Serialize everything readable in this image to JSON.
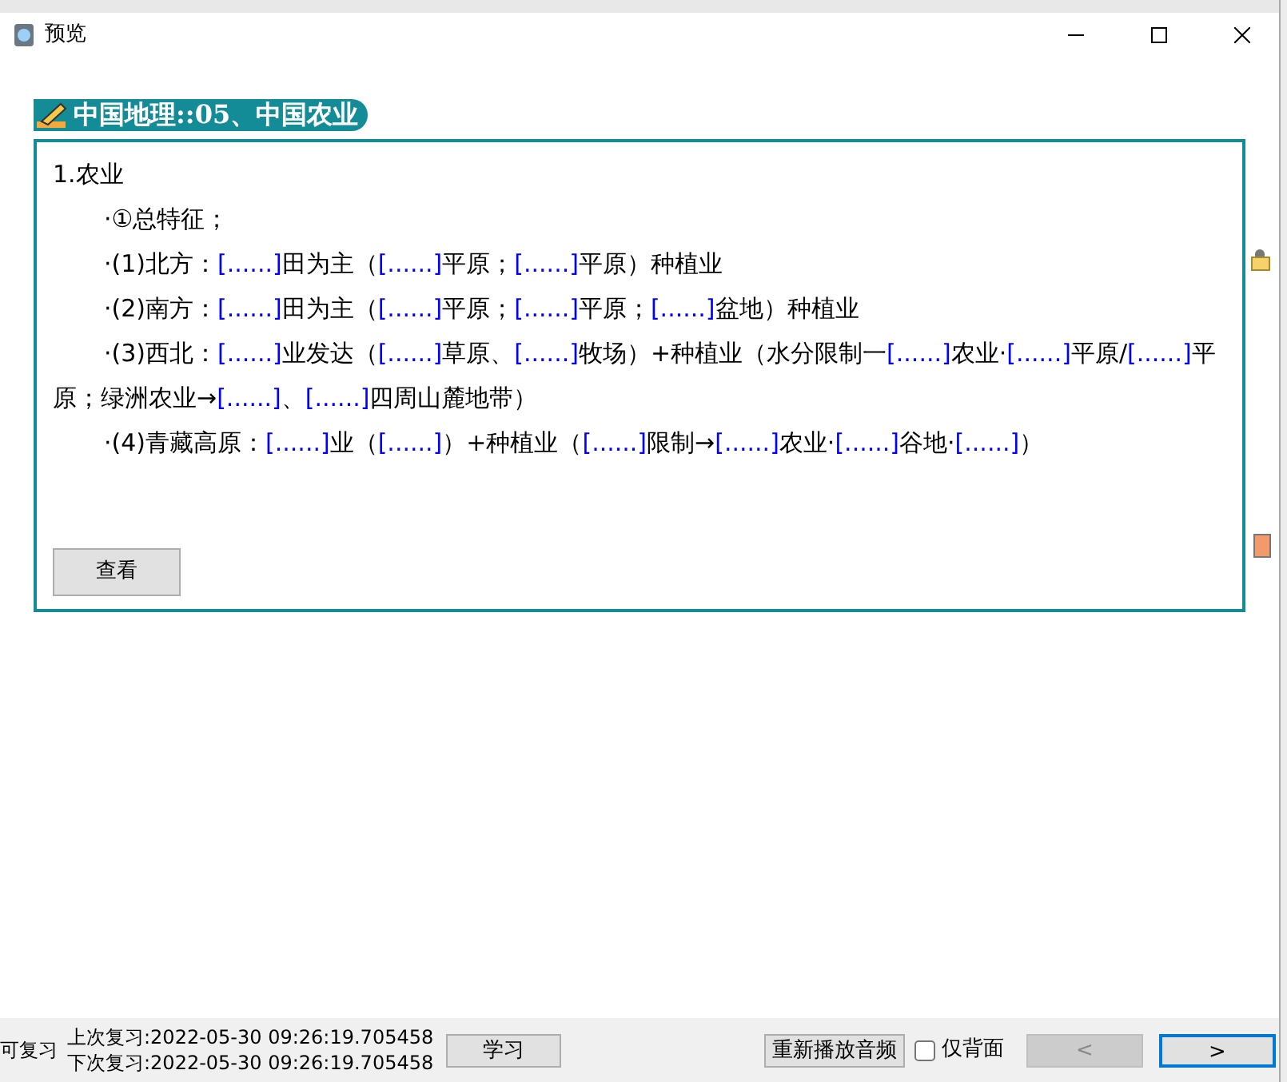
{
  "window": {
    "title": "预览"
  },
  "card": {
    "title": "中国地理::05、中国农业",
    "lines": [
      {
        "indent": false,
        "segments": [
          {
            "kind": "text",
            "text": "1.农业"
          }
        ]
      },
      {
        "indent": true,
        "segments": [
          {
            "kind": "text",
            "text": "·①总特征；"
          }
        ]
      },
      {
        "indent": true,
        "segments": [
          {
            "kind": "text",
            "text": "·(1)北方："
          },
          {
            "kind": "blank",
            "text": "[......]"
          },
          {
            "kind": "text",
            "text": "田为主（"
          },
          {
            "kind": "blank",
            "text": "[......]"
          },
          {
            "kind": "text",
            "text": "平原；"
          },
          {
            "kind": "blank",
            "text": "[......]"
          },
          {
            "kind": "text",
            "text": "平原）种植业"
          }
        ]
      },
      {
        "indent": true,
        "segments": [
          {
            "kind": "text",
            "text": "·(2)南方："
          },
          {
            "kind": "blank",
            "text": "[......]"
          },
          {
            "kind": "text",
            "text": "田为主（"
          },
          {
            "kind": "blank",
            "text": "[......]"
          },
          {
            "kind": "text",
            "text": "平原；"
          },
          {
            "kind": "blank",
            "text": "[......]"
          },
          {
            "kind": "text",
            "text": "平原；"
          },
          {
            "kind": "blank",
            "text": "[......]"
          },
          {
            "kind": "text",
            "text": "盆地）种植业"
          }
        ]
      },
      {
        "indent": true,
        "segments": [
          {
            "kind": "text",
            "text": "·(3)西北："
          },
          {
            "kind": "blank",
            "text": "[......]"
          },
          {
            "kind": "text",
            "text": "业发达（"
          },
          {
            "kind": "blank",
            "text": "[......]"
          },
          {
            "kind": "text",
            "text": "草原、"
          },
          {
            "kind": "blank",
            "text": "[......]"
          },
          {
            "kind": "text",
            "text": "牧场）+种植业（水分限制一"
          },
          {
            "kind": "blank",
            "text": "[......]"
          },
          {
            "kind": "text",
            "text": "农业·"
          },
          {
            "kind": "blank",
            "text": "[......]"
          },
          {
            "kind": "text",
            "text": "平原/"
          },
          {
            "kind": "blank",
            "text": "[......]"
          },
          {
            "kind": "text",
            "text": "平原；绿洲农业→"
          },
          {
            "kind": "blank",
            "text": "[......]"
          },
          {
            "kind": "text",
            "text": "、"
          },
          {
            "kind": "blank",
            "text": "[......]"
          },
          {
            "kind": "text",
            "text": "四周山麓地带）"
          }
        ]
      },
      {
        "indent": true,
        "segments": [
          {
            "kind": "text",
            "text": "·(4)青藏高原："
          },
          {
            "kind": "blank",
            "text": "[......]"
          },
          {
            "kind": "text",
            "text": "业（"
          },
          {
            "kind": "blank",
            "text": "[......]"
          },
          {
            "kind": "text",
            "text": "）+种植业（"
          },
          {
            "kind": "blank",
            "text": "[......]"
          },
          {
            "kind": "text",
            "text": "限制→"
          },
          {
            "kind": "blank",
            "text": "[......]"
          },
          {
            "kind": "text",
            "text": "农业·"
          },
          {
            "kind": "blank",
            "text": "[......]"
          },
          {
            "kind": "text",
            "text": "谷地·"
          },
          {
            "kind": "blank",
            "text": "[......]"
          },
          {
            "kind": "text",
            "text": "）"
          }
        ]
      }
    ],
    "button": "查看"
  },
  "footer": {
    "status": "可复习",
    "last_review": "上次复习:2022-05-30 09:26:19.705458",
    "next_review": "下次复习:2022-05-30 09:26:19.705458",
    "study_button": "学习",
    "replay_button": "重新播放音频",
    "back_only": {
      "label": "仅背面",
      "checked": false
    },
    "prev_button": {
      "label": "<",
      "disabled": true
    },
    "next_button": {
      "label": ">",
      "disabled": false
    }
  }
}
